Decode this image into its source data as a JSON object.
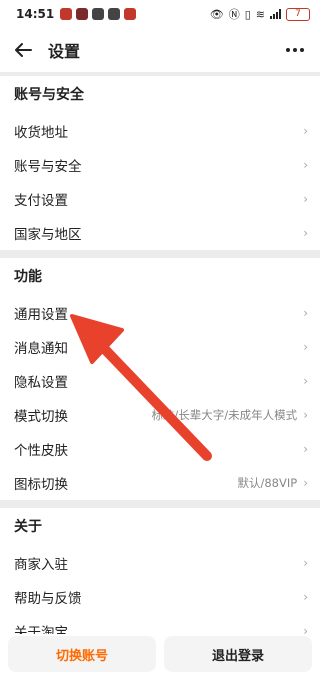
{
  "status_bar": {
    "time": "14:51",
    "battery": "7"
  },
  "header": {
    "title": "设置"
  },
  "sections": [
    {
      "title": "账号与安全",
      "items": [
        {
          "label": "收货地址",
          "value": ""
        },
        {
          "label": "账号与安全",
          "value": ""
        },
        {
          "label": "支付设置",
          "value": ""
        },
        {
          "label": "国家与地区",
          "value": ""
        }
      ]
    },
    {
      "title": "功能",
      "items": [
        {
          "label": "通用设置",
          "value": ""
        },
        {
          "label": "消息通知",
          "value": ""
        },
        {
          "label": "隐私设置",
          "value": ""
        },
        {
          "label": "模式切换",
          "value": "标准/长辈大字/未成年人模式"
        },
        {
          "label": "个性皮肤",
          "value": ""
        },
        {
          "label": "图标切换",
          "value": "默认/88VIP"
        }
      ]
    },
    {
      "title": "关于",
      "items": [
        {
          "label": "商家入驻",
          "value": ""
        },
        {
          "label": "帮助与反馈",
          "value": ""
        },
        {
          "label": "关于淘宝",
          "value": ""
        }
      ]
    }
  ],
  "bottom": {
    "switch_account": "切换账号",
    "logout": "退出登录"
  },
  "colors": {
    "accent": "#ff6a00",
    "annotation_arrow": "#e8412c"
  }
}
